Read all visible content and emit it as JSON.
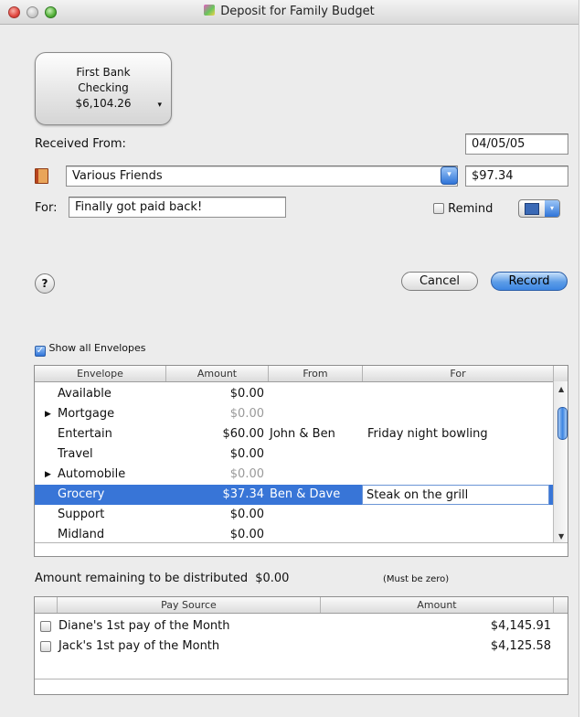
{
  "window": {
    "title": "Deposit for Family Budget"
  },
  "account_button": {
    "line1": "First Bank",
    "line2": "Checking",
    "line3": "$6,104.26",
    "arrow": "▾"
  },
  "form": {
    "received_from_label": "Received From:",
    "date_value": "04/05/05",
    "payee_value": "Various Friends",
    "amount_value": "$97.34",
    "for_label": "For:",
    "for_value": "Finally got paid back!",
    "remind_label": "Remind"
  },
  "buttons": {
    "help": "?",
    "cancel": "Cancel",
    "record": "Record"
  },
  "envelopes": {
    "show_all_label": "Show all Envelopes",
    "show_all_checked": true,
    "headers": [
      "Envelope",
      "Amount",
      "From",
      "For"
    ],
    "rows": [
      {
        "envelope": "Available",
        "amount": "$0.00",
        "from": "",
        "for": "",
        "muted": false,
        "expand": "",
        "selected": false
      },
      {
        "envelope": "Mortgage",
        "amount": "$0.00",
        "from": "",
        "for": "",
        "muted": true,
        "expand": "▶",
        "selected": false
      },
      {
        "envelope": "Entertain",
        "amount": "$60.00",
        "from": "John & Ben",
        "for": "Friday night bowling",
        "muted": false,
        "expand": "",
        "selected": false
      },
      {
        "envelope": "Travel",
        "amount": "$0.00",
        "from": "",
        "for": "",
        "muted": false,
        "expand": "",
        "selected": false
      },
      {
        "envelope": "Automobile",
        "amount": "$0.00",
        "from": "",
        "for": "",
        "muted": true,
        "expand": "▶",
        "selected": false
      },
      {
        "envelope": "Grocery",
        "amount": "$37.34",
        "from": "Ben & Dave",
        "for": "Steak on the grill",
        "muted": false,
        "expand": "",
        "selected": true
      },
      {
        "envelope": "Support",
        "amount": "$0.00",
        "from": "",
        "for": "",
        "muted": false,
        "expand": "",
        "selected": false
      },
      {
        "envelope": "Midland",
        "amount": "$0.00",
        "from": "",
        "for": "",
        "muted": false,
        "expand": "",
        "selected": false
      }
    ]
  },
  "remaining": {
    "label": "Amount remaining to be distributed",
    "value": "$0.00",
    "note": "(Must be zero)"
  },
  "pay_sources": {
    "headers": [
      "Pay Source",
      "Amount"
    ],
    "rows": [
      {
        "name": "Diane's 1st pay of the Month",
        "amount": "$4,145.91",
        "checked": false
      },
      {
        "name": "Jack's 1st pay of the Month",
        "amount": "$4,125.58",
        "checked": false
      }
    ]
  },
  "colors": {
    "selection": "#3875d7",
    "accent": "#2f74d8",
    "window_bg": "#ececec"
  }
}
